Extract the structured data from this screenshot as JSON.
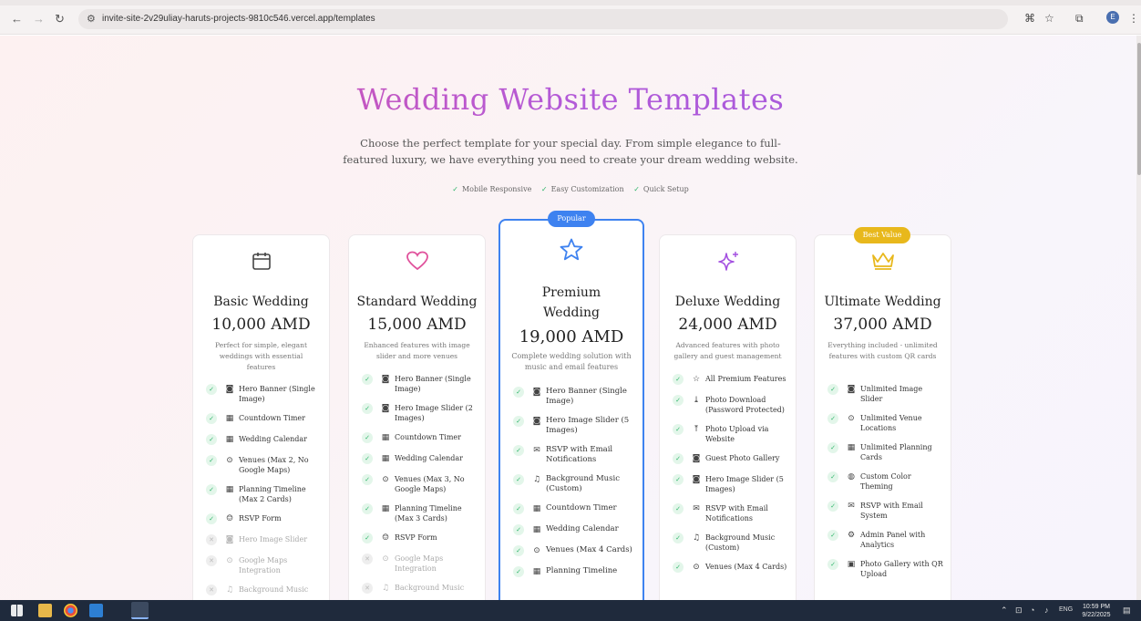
{
  "browser": {
    "url": "invite-site-2v29uliay-haruts-projects-9810c546.vercel.app/templates",
    "profile_initial": "E"
  },
  "hero": {
    "title": "Wedding Website Templates",
    "subtitle": "Choose the perfect template for your special day. From simple elegance to full-featured luxury, we have everything you need to create your dream wedding website.",
    "features": [
      "Mobile Responsive",
      "Easy Customization",
      "Quick Setup"
    ]
  },
  "colors": {
    "accent_blue": "#3e82f0",
    "best_value": "#e8b81c",
    "check_green": "#2fb56a",
    "title_gradient_start": "#e0529c",
    "title_gradient_end": "#9a5ae0"
  },
  "cards": [
    {
      "name": "Basic Wedding",
      "price": "10,000 AMD",
      "description": "Perfect for simple, elegant weddings with essential features",
      "icon": "calendar-icon",
      "features": [
        {
          "label": "Hero Banner (Single Image)",
          "icon": "camera-icon",
          "included": true
        },
        {
          "label": "Countdown Timer",
          "icon": "calendar-icon",
          "included": true
        },
        {
          "label": "Wedding Calendar",
          "icon": "calendar-icon",
          "included": true
        },
        {
          "label": "Venues (Max 2, No Google Maps)",
          "icon": "pin-icon",
          "included": true
        },
        {
          "label": "Planning Timeline (Max 2 Cards)",
          "icon": "calendar-icon",
          "included": true
        },
        {
          "label": "RSVP Form",
          "icon": "users-icon",
          "included": true
        },
        {
          "label": "Hero Image Slider",
          "icon": "camera-icon",
          "included": false
        },
        {
          "label": "Google Maps Integration",
          "icon": "pin-icon",
          "included": false
        },
        {
          "label": "Background Music",
          "icon": "music-icon",
          "included": false
        }
      ]
    },
    {
      "name": "Standard Wedding",
      "price": "15,000 AMD",
      "description": "Enhanced features with image slider and more venues",
      "icon": "heart-icon",
      "features": [
        {
          "label": "Hero Banner (Single Image)",
          "icon": "camera-icon",
          "included": true
        },
        {
          "label": "Hero Image Slider (2 Images)",
          "icon": "camera-icon",
          "included": true
        },
        {
          "label": "Countdown Timer",
          "icon": "calendar-icon",
          "included": true
        },
        {
          "label": "Wedding Calendar",
          "icon": "calendar-icon",
          "included": true
        },
        {
          "label": "Venues (Max 3, No Google Maps)",
          "icon": "pin-icon",
          "included": true
        },
        {
          "label": "Planning Timeline (Max 3 Cards)",
          "icon": "calendar-icon",
          "included": true
        },
        {
          "label": "RSVP Form",
          "icon": "users-icon",
          "included": true
        },
        {
          "label": "Google Maps Integration",
          "icon": "pin-icon",
          "included": false
        },
        {
          "label": "Background Music",
          "icon": "music-icon",
          "included": false
        }
      ]
    },
    {
      "name": "Premium Wedding",
      "price": "19,000 AMD",
      "description": "Complete wedding solution with music and email features",
      "icon": "star-icon",
      "badge": "Popular",
      "features": [
        {
          "label": "Hero Banner (Single Image)",
          "icon": "camera-icon",
          "included": true
        },
        {
          "label": "Hero Image Slider (5 Images)",
          "icon": "camera-icon",
          "included": true
        },
        {
          "label": "RSVP with Email Notifications",
          "icon": "mail-icon",
          "included": true
        },
        {
          "label": "Background Music (Custom)",
          "icon": "music-icon",
          "included": true
        },
        {
          "label": "Countdown Timer",
          "icon": "calendar-icon",
          "included": true
        },
        {
          "label": "Wedding Calendar",
          "icon": "calendar-icon",
          "included": true
        },
        {
          "label": "Venues (Max 4 Cards)",
          "icon": "pin-icon",
          "included": true
        },
        {
          "label": "Planning Timeline",
          "icon": "calendar-icon",
          "included": true
        }
      ]
    },
    {
      "name": "Deluxe Wedding",
      "price": "24,000 AMD",
      "description": "Advanced features with photo gallery and guest management",
      "icon": "sparkles-icon",
      "features": [
        {
          "label": "All Premium Features",
          "icon": "star-icon",
          "included": true
        },
        {
          "label": "Photo Download (Password Protected)",
          "icon": "download-icon",
          "included": true
        },
        {
          "label": "Photo Upload via Website",
          "icon": "upload-icon",
          "included": true
        },
        {
          "label": "Guest Photo Gallery",
          "icon": "camera-icon",
          "included": true
        },
        {
          "label": "Hero Image Slider (5 Images)",
          "icon": "camera-icon",
          "included": true
        },
        {
          "label": "RSVP with Email Notifications",
          "icon": "mail-icon",
          "included": true
        },
        {
          "label": "Background Music (Custom)",
          "icon": "music-icon",
          "included": true
        },
        {
          "label": "Venues (Max 4 Cards)",
          "icon": "pin-icon",
          "included": true
        }
      ]
    },
    {
      "name": "Ultimate Wedding",
      "price": "37,000 AMD",
      "description": "Everything included - unlimited features with custom QR cards",
      "icon": "crown-icon",
      "badge": "Best Value",
      "features": [
        {
          "label": "Unlimited Image Slider",
          "icon": "camera-icon",
          "included": true
        },
        {
          "label": "Unlimited Venue Locations",
          "icon": "pin-icon",
          "included": true
        },
        {
          "label": "Unlimited Planning Cards",
          "icon": "calendar-icon",
          "included": true
        },
        {
          "label": "Custom Color Theming",
          "icon": "palette-icon",
          "included": true
        },
        {
          "label": "RSVP with Email System",
          "icon": "mail-icon",
          "included": true
        },
        {
          "label": "Admin Panel with Analytics",
          "icon": "gear-icon",
          "included": true
        },
        {
          "label": "Photo Gallery with QR Upload",
          "icon": "qr-icon",
          "included": true
        }
      ]
    }
  ],
  "taskbar": {
    "time": "10:59 PM",
    "date": "9/22/2025",
    "language": "ENG"
  }
}
